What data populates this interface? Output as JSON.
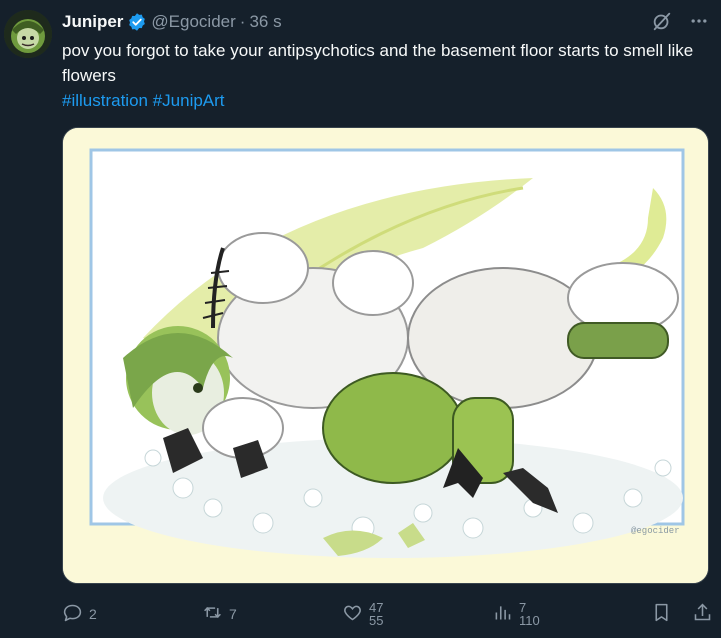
{
  "author": {
    "display_name": "Juniper",
    "handle": "@Egocider",
    "separator": "·",
    "time": "36 s",
    "verified": true
  },
  "tweet": {
    "text": "pov you forgot to take your antipsychotics and the basement floor starts to smell like flowers",
    "hashtags": "#illustration #JunipArt"
  },
  "media": {
    "kind": "illustration",
    "watermark": "@egocider"
  },
  "actions": {
    "replies": "2",
    "reposts": "7",
    "likes_old": "47",
    "likes_new": "55",
    "views_old": "7",
    "views_new": "110"
  },
  "icons": [
    "avatar",
    "verified-badge-icon",
    "grok-icon",
    "more-icon",
    "reply-icon",
    "repost-icon",
    "like-icon",
    "views-icon",
    "bookmark-icon",
    "share-icon"
  ],
  "colors": {
    "background": "#15202b",
    "text": "#f7f9f9",
    "muted": "#8b98a5",
    "link": "#1d9bf0",
    "art_bg": "#fbf9d8",
    "art_frame": "#9fc6e6",
    "creature_green": "#8fb94a"
  }
}
